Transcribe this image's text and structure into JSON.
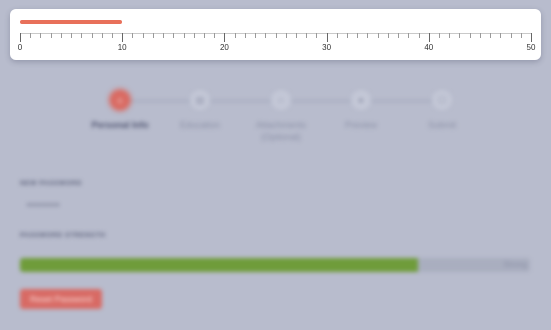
{
  "ruler": {
    "min": 0,
    "max": 50,
    "value": 10,
    "major_labels": [
      "0",
      "10",
      "20",
      "30",
      "40",
      "50"
    ],
    "progress_color": "#e8705a"
  },
  "stepper": {
    "steps": [
      {
        "label": "Personal Info",
        "icon": "home-icon",
        "active": true
      },
      {
        "label": "Education",
        "icon": "document-icon",
        "active": false
      },
      {
        "label": "Attachments (Optional)",
        "icon": "attachment-icon",
        "active": false
      },
      {
        "label": "Preview",
        "icon": "eye-icon",
        "active": false
      },
      {
        "label": "Submit",
        "icon": "check-icon",
        "active": false
      }
    ],
    "active_color": "#d96a62"
  },
  "password": {
    "label": "NEW PASSWORD",
    "value": "••••••••"
  },
  "strength": {
    "label": "PASSWORD STRENGTH",
    "level_text": "Strong",
    "fraction": 0.78,
    "color": "#6f9c3a"
  },
  "reset_button": {
    "label": "Reset Password",
    "color": "#d86a64"
  }
}
